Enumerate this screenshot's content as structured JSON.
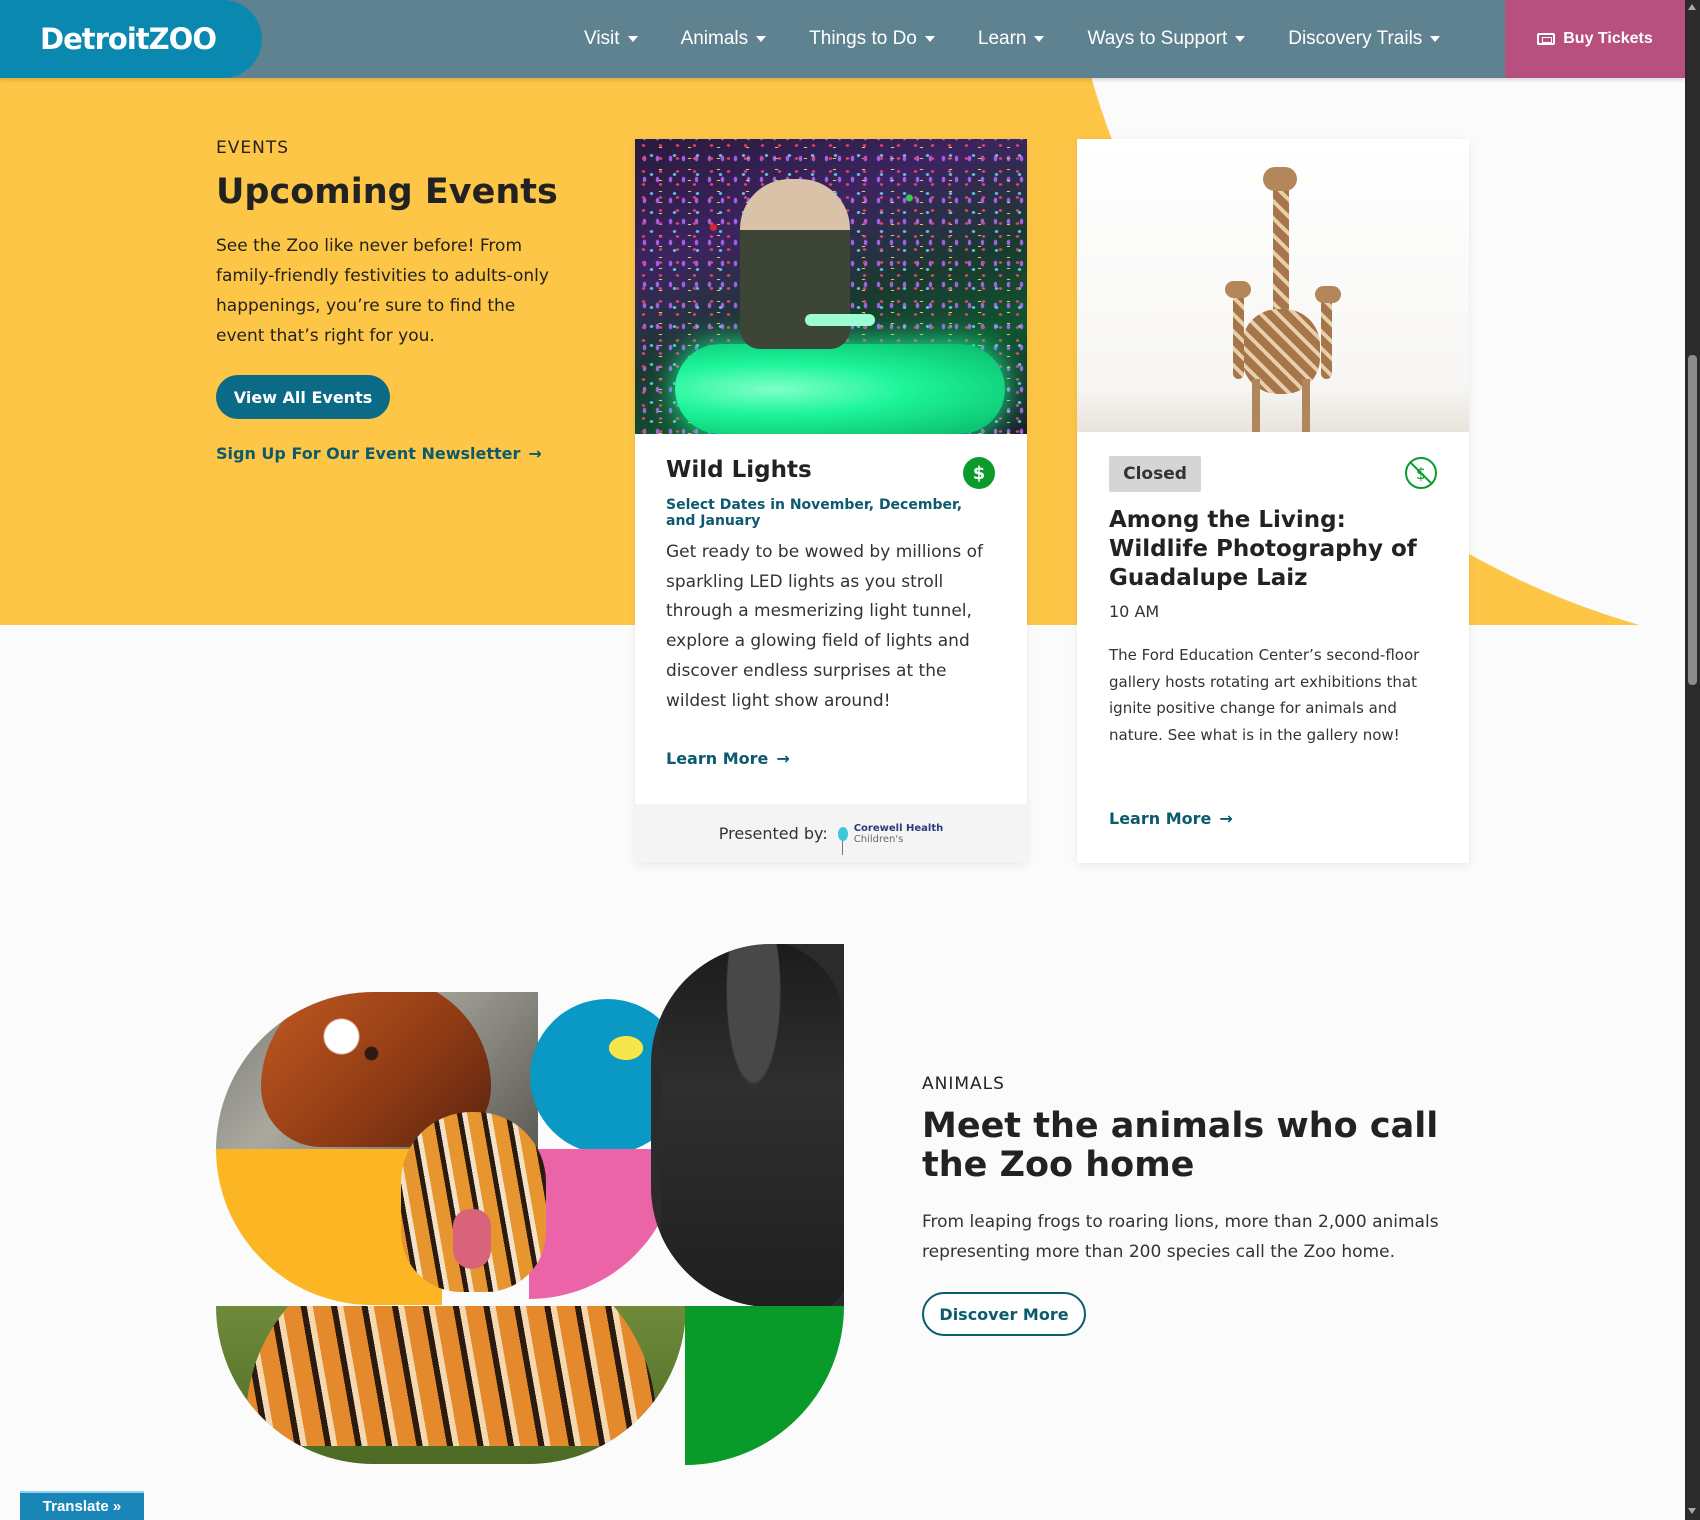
{
  "header": {
    "logo": "DetroitZOO",
    "nav": [
      {
        "label": "Visit"
      },
      {
        "label": "Animals"
      },
      {
        "label": "Things to Do"
      },
      {
        "label": "Learn"
      },
      {
        "label": "Ways to Support"
      },
      {
        "label": "Discovery Trails"
      }
    ],
    "buy_tickets": "Buy Tickets"
  },
  "events": {
    "eyebrow": "EVENTS",
    "title": "Upcoming Events",
    "description": "See the Zoo like never before! From family-friendly festivities to adults-only happenings, you’re sure to find the event that’s right for you.",
    "view_all": "View All Events",
    "newsletter_link": "Sign Up For Our Event Newsletter",
    "cards": [
      {
        "title": "Wild Lights",
        "dates": "Select Dates in November, December, and January",
        "text": "Get ready to be wowed by millions of sparkling LED lights as you stroll through a mesmerizing light tunnel, explore a glowing field of lights and discover endless surprises at the wildest light show around!",
        "learn_more": "Learn More",
        "price_badge": "$",
        "presented_by": "Presented by:",
        "sponsor_line1": "Corewell Health",
        "sponsor_line2": "Children's"
      },
      {
        "status": "Closed",
        "title": "Among the Living: Wildlife Photography of Guadalupe Laiz",
        "time": "10 AM",
        "text": "The Ford Education Center’s second-floor gallery hosts rotating art exhibitions that ignite positive change for animals and nature. See what is in the gallery now!",
        "learn_more": "Learn More",
        "price_badge": "$"
      }
    ]
  },
  "animals": {
    "eyebrow": "ANIMALS",
    "title": "Meet the animals who call the Zoo home",
    "description": "From leaping frogs to roaring lions, more than 2,000 animals representing more than 200 species call the Zoo home.",
    "discover_more": "Discover More"
  },
  "translate": "Translate »",
  "colors": {
    "header": "#5f8291",
    "logo_bg": "#0a88b0",
    "buy_tickets_bg": "#b74f7f",
    "events_bg": "#fec647",
    "primary_button": "#0b6a86",
    "link": "#0b5a6e",
    "badge_green": "#0a9b2b"
  }
}
